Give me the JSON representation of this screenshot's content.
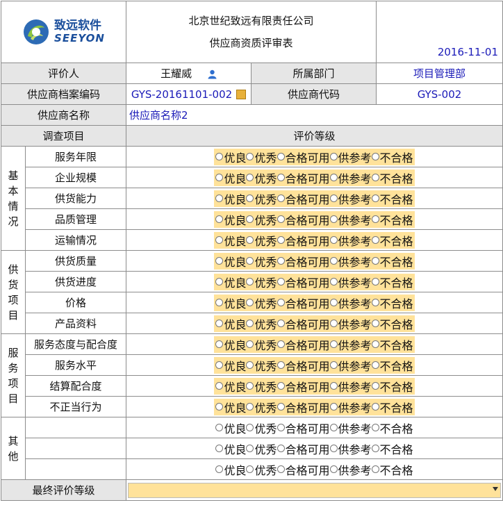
{
  "header": {
    "logo": {
      "cn": "致远软件",
      "en": "SEEYON"
    },
    "title_line1": "北京世纪致远有限责任公司",
    "title_line2": "供应商资质评审表",
    "date": "2016-11-01"
  },
  "info": {
    "evaluator_label": "评价人",
    "evaluator": "王耀威",
    "department_label": "所属部门",
    "department": "项目管理部",
    "archive_code_label": "供应商档案编码",
    "archive_code": "GYS-20161101-002",
    "supplier_code_label": "供应商代码",
    "supplier_code": "GYS-002",
    "supplier_name_label": "供应商名称",
    "supplier_name": "供应商名称2"
  },
  "table_header": {
    "items": "调查项目",
    "grade": "评价等级"
  },
  "rating_options": [
    "优良",
    "优秀",
    "合格可用",
    "供参考",
    "不合格"
  ],
  "categories": [
    {
      "name": [
        "基",
        "本",
        "情",
        "况"
      ],
      "items": [
        "服务年限",
        "企业规模",
        "供货能力",
        "品质管理",
        "运输情况"
      ]
    },
    {
      "name": [
        "供",
        "货",
        "项",
        "目"
      ],
      "items": [
        "供货质量",
        "供货进度",
        "价格",
        "产品资料"
      ]
    },
    {
      "name": [
        "服",
        "务",
        "项",
        "目"
      ],
      "items": [
        "服务态度与配合度",
        "服务水平",
        "结算配合度",
        "不正当行为"
      ]
    },
    {
      "name": [
        "其",
        "他"
      ],
      "items": [
        "",
        "",
        ""
      ]
    }
  ],
  "final": {
    "label": "最终评价等级",
    "value": ""
  },
  "colors": {
    "highlight": "#ffe29a",
    "label_bg": "#e6e6e6",
    "value_text": "#1a1ab8"
  }
}
